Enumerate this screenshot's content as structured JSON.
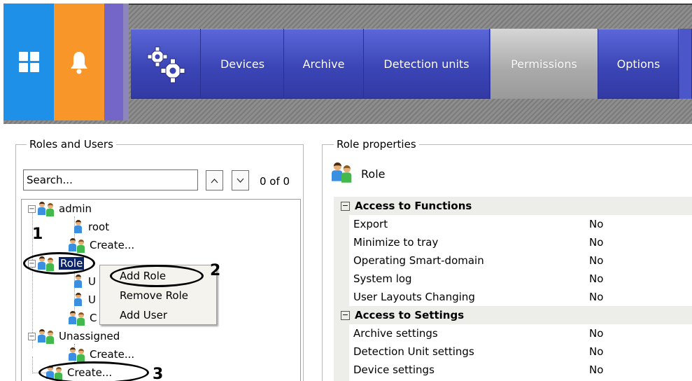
{
  "tiles": {
    "windows_icon": "windows-icon",
    "bell_icon": "bell-icon",
    "settings_icon": "gears-icon"
  },
  "nav": {
    "tabs": [
      {
        "label": "Devices",
        "active": false
      },
      {
        "label": "Archive",
        "active": false
      },
      {
        "label": "Detection units",
        "active": false
      },
      {
        "label": "Permissions",
        "active": true
      },
      {
        "label": "Options",
        "active": false
      }
    ]
  },
  "roles_panel": {
    "title": "Roles and Users",
    "search_value": "Search...",
    "up_arrow": "^",
    "down_arrow": "v",
    "count": "0 of 0",
    "tree": {
      "admin": "admin",
      "root": "root",
      "create_user_1": "Create...",
      "role": "Role",
      "user_a": "U",
      "user_b": "U",
      "create_user_2": "C",
      "unassigned": "Unassigned",
      "create_user_3": "Create...",
      "create_role": "Create..."
    },
    "context_menu": [
      "Add Role",
      "Remove Role",
      "Add User"
    ]
  },
  "annotations": [
    "1",
    "2",
    "3"
  ],
  "properties_panel": {
    "title": "Role properties",
    "header_label": "Role",
    "categories": [
      {
        "name": "Access to Functions",
        "rows": [
          {
            "name": "Export",
            "value": "No"
          },
          {
            "name": "Minimize to tray",
            "value": "No"
          },
          {
            "name": "Operating Smart-domain",
            "value": "No"
          },
          {
            "name": "System log",
            "value": "No"
          },
          {
            "name": "User Layouts Changing",
            "value": "No"
          }
        ]
      },
      {
        "name": "Access to Settings",
        "rows": [
          {
            "name": "Archive settings",
            "value": "No"
          },
          {
            "name": "Detection Unit settings",
            "value": "No"
          },
          {
            "name": "Device settings",
            "value": "No"
          }
        ]
      }
    ]
  },
  "colors": {
    "nav_blue": "#3b45b6",
    "tile_blue": "#1e90e8",
    "tile_orange": "#f8962a",
    "selection": "#0a246a"
  }
}
